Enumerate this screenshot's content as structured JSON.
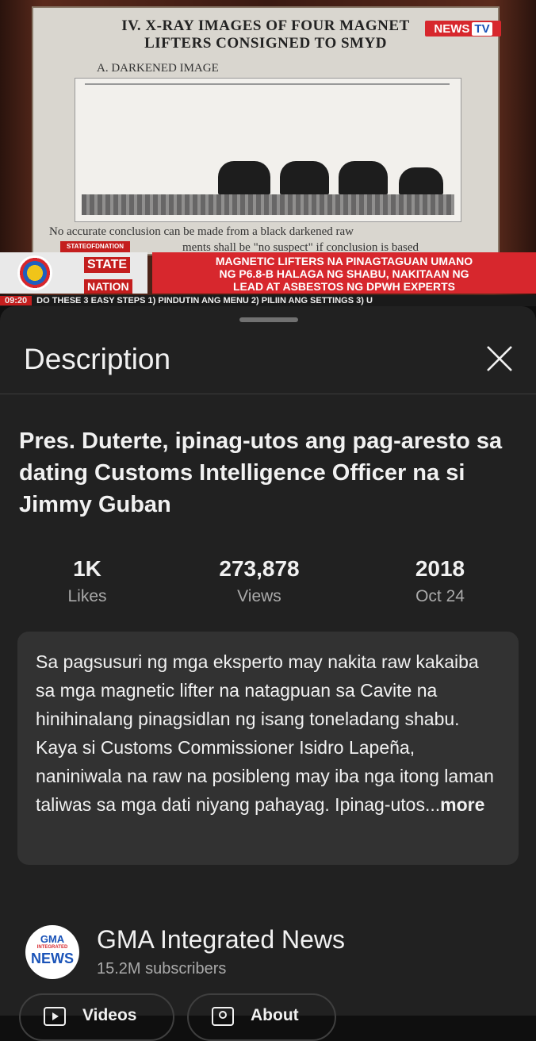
{
  "video": {
    "slide_title_line1": "IV. X-RAY IMAGES OF FOUR MAGNET",
    "slide_title_line2": "LIFTERS CONSIGNED TO SMYD",
    "slide_subtitle": "A. DARKENED IMAGE",
    "slide_footer_line1": "No accurate conclusion can be made from a black darkened raw",
    "slide_footer_line2": "ments shall be \"no suspect\" if conclusion is based",
    "channel_badge": "NEWS",
    "channel_badge_tv": "TV",
    "social_tag": "STATEOFDNATION",
    "show_name_line1": "STATE",
    "show_name_line2": "NATION",
    "headline_line1": "MAGNETIC LIFTERS NA PINAGTAGUAN UMANO",
    "headline_line2": "NG P6.8-B HALAGA NG SHABU, NAKITAAN NG",
    "headline_line3": "LEAD AT ASBESTOS NG DPWH EXPERTS",
    "ticker_time": "09:20",
    "ticker_text": "DO THESE 3 EASY STEPS 1) PINDUTIN ANG MENU 2) PILIIN ANG SETTINGS 3) U"
  },
  "sheet": {
    "title": "Description",
    "close_icon": "close-icon"
  },
  "video_title": "Pres. Duterte, ipinag-utos ang pag-aresto sa dating Customs Intelligence Officer na si Jimmy Guban",
  "stats": [
    {
      "value": "1K",
      "label": "Likes"
    },
    {
      "value": "273,878",
      "label": "Views"
    },
    {
      "value": "2018",
      "label": "Oct 24"
    }
  ],
  "description": {
    "text": "Sa pagsusuri ng mga eksperto may nakita raw kakaiba sa mga magnetic lifter na natagpuan sa Cavite na hinihinalang pinagsidlan ng isang toneladang shabu. Kaya si Customs Commissioner Isidro Lapeña, naniniwala na raw na posibleng may iba nga itong laman taliwas sa mga dati niyang pahayag. Ipinag-utos...",
    "more_label": "more"
  },
  "channel": {
    "name": "GMA Integrated News",
    "subscribers": "15.2M subscribers",
    "avatar_line1": "GMA",
    "avatar_line2": "INTEGRATED",
    "avatar_line3": "NEWS"
  },
  "buttons": {
    "videos_label": "Videos",
    "about_label": "About"
  },
  "colors": {
    "background": "#0f0f0f",
    "sheet": "#212121",
    "description_box": "#323232",
    "secondary_text": "#aaaaaa",
    "broadcast_red": "#d7272d"
  }
}
